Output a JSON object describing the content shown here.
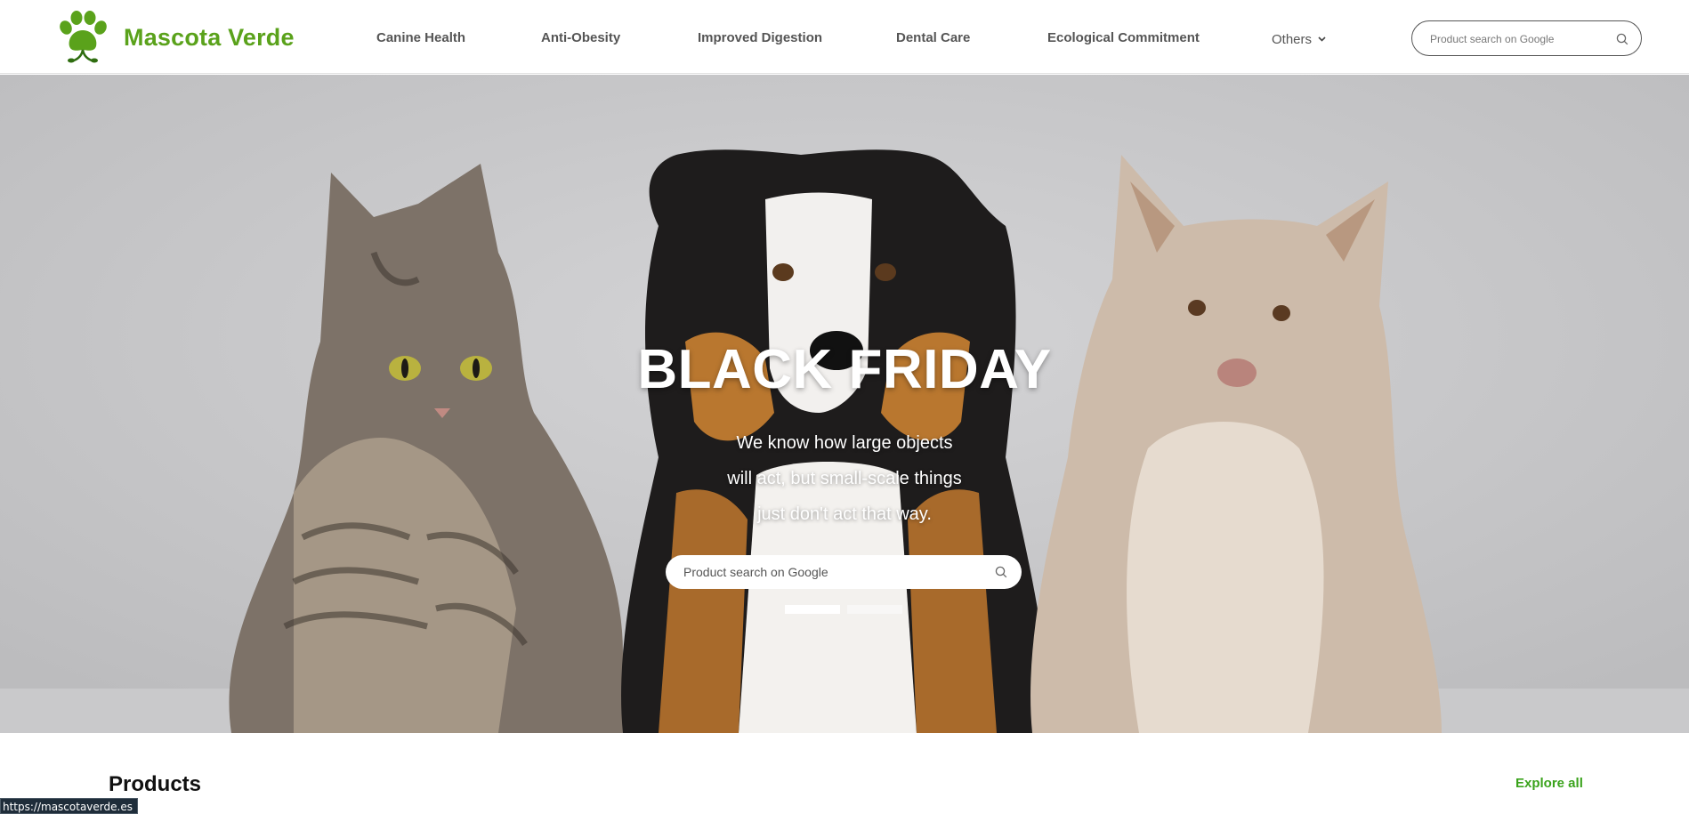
{
  "brand": {
    "name": "Mascota Verde",
    "color": "#5aa21b",
    "logo_icon": "green-paw-icon"
  },
  "nav": {
    "items": [
      {
        "label": "Canine Health"
      },
      {
        "label": "Anti-Obesity"
      },
      {
        "label": "Improved Digestion"
      },
      {
        "label": "Dental Care"
      },
      {
        "label": "Ecological Commitment"
      }
    ],
    "others_label": "Others"
  },
  "header_search": {
    "placeholder": "Product search on Google",
    "icon": "search-icon"
  },
  "hero": {
    "title": "BLACK FRIDAY",
    "lines": [
      "We know how large objects",
      "will act, but small-scale things",
      "just don't act that way."
    ],
    "search_placeholder": "Product search on Google",
    "slides": {
      "count": 2,
      "active": 1
    },
    "image_subject": "cat-and-two-dogs-photo"
  },
  "products": {
    "title": "Products",
    "explore_label": "Explore all",
    "explore_color": "#3aa31c"
  },
  "status_bar": {
    "url": "https://mascotaverde.es"
  }
}
